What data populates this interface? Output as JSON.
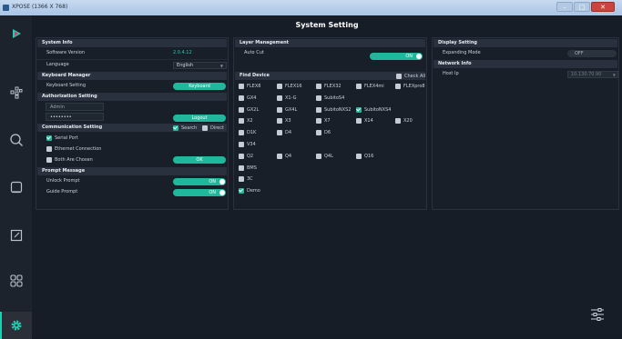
{
  "window": {
    "title": "XPOSE (1366 X 768)",
    "minimize": "–",
    "maximize": "□",
    "close": "✕"
  },
  "page_title": "System Setting",
  "sidebar": {
    "items": [
      {
        "name": "logo",
        "icon": "play-logo-icon"
      },
      {
        "name": "layout",
        "icon": "layout-nodes-icon"
      },
      {
        "name": "search",
        "icon": "search-icon"
      },
      {
        "name": "window",
        "icon": "window-icon"
      },
      {
        "name": "edit",
        "icon": "edit-icon"
      },
      {
        "name": "grid",
        "icon": "grid-icon"
      },
      {
        "name": "settings",
        "icon": "gear-icon",
        "active": true
      }
    ]
  },
  "system_info": {
    "title": "System Info",
    "software_version_label": "Software Version",
    "software_version": "2.0.4.12",
    "language_label": "Language",
    "language_value": "English"
  },
  "keyboard_manager": {
    "title": "Keyboard Manager",
    "setting_label": "Keyboard Setting",
    "button": "Keyboard"
  },
  "authorization": {
    "title": "Authorization Setting",
    "user_value": "Admin",
    "password_value": "••••••••",
    "logout": "Logout"
  },
  "communication": {
    "title": "Communication Setting",
    "search": "Search",
    "direct": "Direct",
    "serial_port": "Serial Port",
    "ethernet": "Ethernet Connection",
    "both": "Both Are Chosen",
    "ok": "OK"
  },
  "prompt": {
    "title": "Prompt Message",
    "unlock_label": "Unlock Prompt",
    "unlock_state": "ON",
    "guide_label": "Guide Prompt",
    "guide_state": "ON"
  },
  "layer_management": {
    "title": "Layer Management",
    "auto_cut_label": "Auto Cut",
    "auto_cut_state": "ON"
  },
  "find_device": {
    "title": "Find Device",
    "check_all": "Check All",
    "rows": [
      [
        {
          "label": "FLEX8",
          "checked": false
        },
        {
          "label": "FLEX16",
          "checked": false
        },
        {
          "label": "FLEX32",
          "checked": false
        },
        {
          "label": "FLEX4mi",
          "checked": false
        },
        {
          "label": "FLEXpro8",
          "checked": false
        }
      ],
      [
        {
          "label": "GX4",
          "checked": false
        },
        {
          "label": "X1-G",
          "checked": false
        },
        {
          "label": "SubitoS4",
          "checked": false
        }
      ],
      [
        {
          "label": "GX2L",
          "checked": false
        },
        {
          "label": "GX4L",
          "checked": false
        },
        {
          "label": "SubitoNXS2",
          "checked": false
        },
        {
          "label": "SubitoNXS4",
          "checked": true
        }
      ],
      [
        {
          "label": "X2",
          "checked": false
        },
        {
          "label": "X3",
          "checked": false
        },
        {
          "label": "X7",
          "checked": false
        },
        {
          "label": "X14",
          "checked": false
        },
        {
          "label": "X20",
          "checked": false
        }
      ],
      [
        {
          "label": "D1K",
          "checked": false
        },
        {
          "label": "D4",
          "checked": false
        },
        {
          "label": "D6",
          "checked": false
        }
      ],
      [
        {
          "label": "V34",
          "checked": false
        }
      ],
      [
        {
          "label": "Q2",
          "checked": false
        },
        {
          "label": "Q4",
          "checked": false
        },
        {
          "label": "Q4L",
          "checked": false
        },
        {
          "label": "Q16",
          "checked": false
        }
      ],
      [
        {
          "label": "BMS",
          "checked": false
        }
      ],
      [
        {
          "label": "3C",
          "checked": false
        }
      ],
      [
        {
          "label": "Demo",
          "checked": true
        }
      ]
    ]
  },
  "display_setting": {
    "title": "Display Setting",
    "expanding_label": "Expanding Mode",
    "expanding_state": "OFF"
  },
  "network_info": {
    "title": "Network Info",
    "host_ip_label": "Host Ip",
    "host_ip_value": "10.130.70.90"
  },
  "colors": {
    "accent": "#1fb89c",
    "background": "#161d27",
    "panel": "#181f29",
    "section_header": "#28313d",
    "sidebar": "#1d232c"
  }
}
